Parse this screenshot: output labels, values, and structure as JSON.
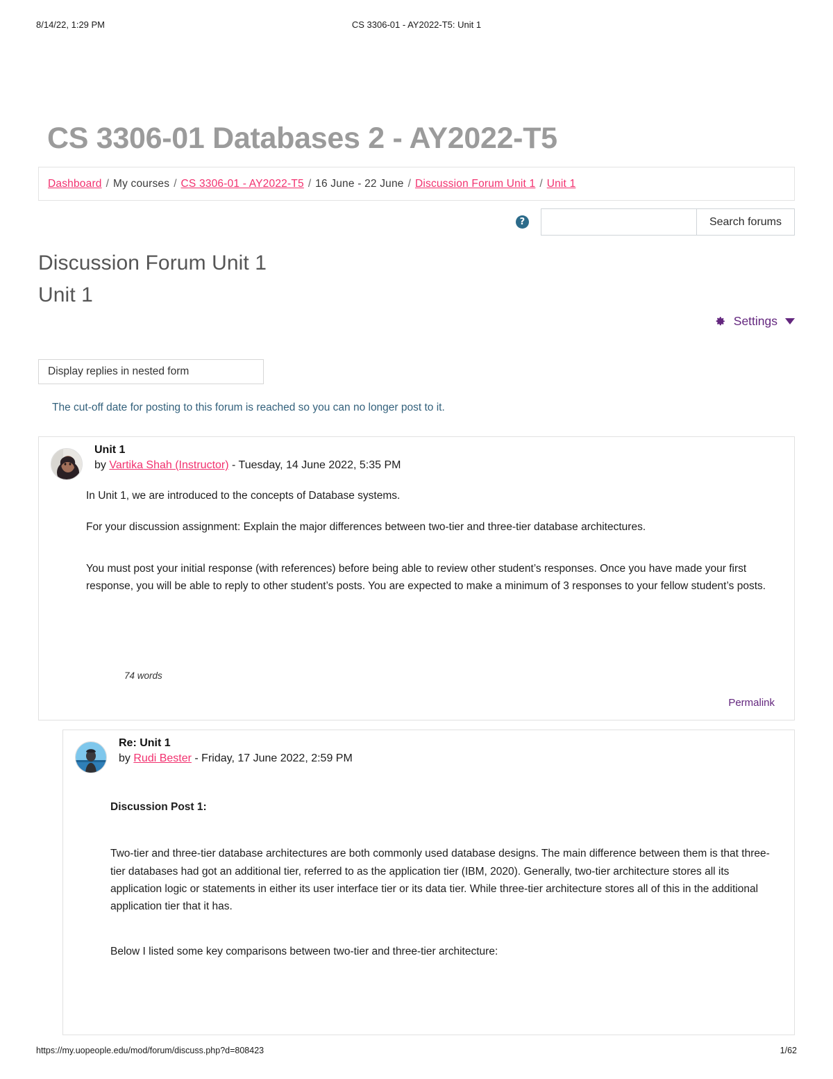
{
  "print_header": {
    "left": "8/14/22, 1:29 PM",
    "center": "CS 3306-01 - AY2022-T5: Unit 1"
  },
  "print_footer": {
    "url": "https://my.uopeople.edu/mod/forum/discuss.php?d=808423",
    "page": "1/62"
  },
  "course_title": "CS 3306-01 Databases 2 - AY2022-T5",
  "breadcrumb": {
    "items": [
      {
        "label": "Dashboard",
        "link": true
      },
      {
        "label": "My courses",
        "link": false
      },
      {
        "label": "CS 3306-01 - AY2022-T5",
        "link": true
      },
      {
        "label": "16 June - 22 June",
        "link": false
      },
      {
        "label": "Discussion Forum Unit 1",
        "link": true
      },
      {
        "label": "Unit 1",
        "link": true
      }
    ],
    "separator": "/"
  },
  "search": {
    "help_icon": "help-circle-icon",
    "value": "",
    "placeholder": "",
    "button_label": "Search forums"
  },
  "forum": {
    "title": "Discussion Forum Unit 1",
    "subtitle": "Unit 1",
    "settings_label": "Settings",
    "settings_icon": "gear-icon",
    "display_mode": "Display replies in nested form",
    "cutoff_note": "The cut-off date for posting to this forum is reached so you can no longer post to it."
  },
  "colors": {
    "link_pink": "#f2316f",
    "purple": "#63267e",
    "title_grey": "#9b9b9b",
    "note_blue": "#33617c",
    "help_teal": "#2c6b8a"
  },
  "posts": [
    {
      "subject": "Unit 1",
      "by_prefix": "by",
      "author": "Vartika Shah (Instructor)",
      "date": "- Tuesday, 14 June 2022, 5:35 PM",
      "paragraphs": [
        "In Unit 1, we are introduced to the concepts of Database systems.",
        "For your discussion assignment: Explain the major differences between two-tier and three-tier database architectures.",
        "You must post your initial response (with references) before being able to review other student’s responses.  Once you have made your first response, you will be able to reply to other student’s posts.  You are expected to make a minimum of 3 responses to your fellow student’s posts."
      ],
      "word_count": "74 words",
      "permalink_label": "Permalink"
    },
    {
      "subject": "Re: Unit 1",
      "by_prefix": "by",
      "author": "Rudi Bester",
      "date": "- Friday, 17 June 2022, 2:59 PM",
      "heading": "Discussion Post 1:",
      "paragraphs": [
        "Two-tier and three-tier database architectures are both commonly used database designs. The main difference between them is that three-tier databases had got an additional tier, referred to as the application tier (IBM, 2020). Generally, two-tier architecture stores all its application logic or statements in either its user interface tier or its data tier. While three-tier architecture stores all of this in the additional application tier that it has.",
        "Below I listed some key comparisons between two-tier and three-tier architecture:"
      ]
    }
  ]
}
